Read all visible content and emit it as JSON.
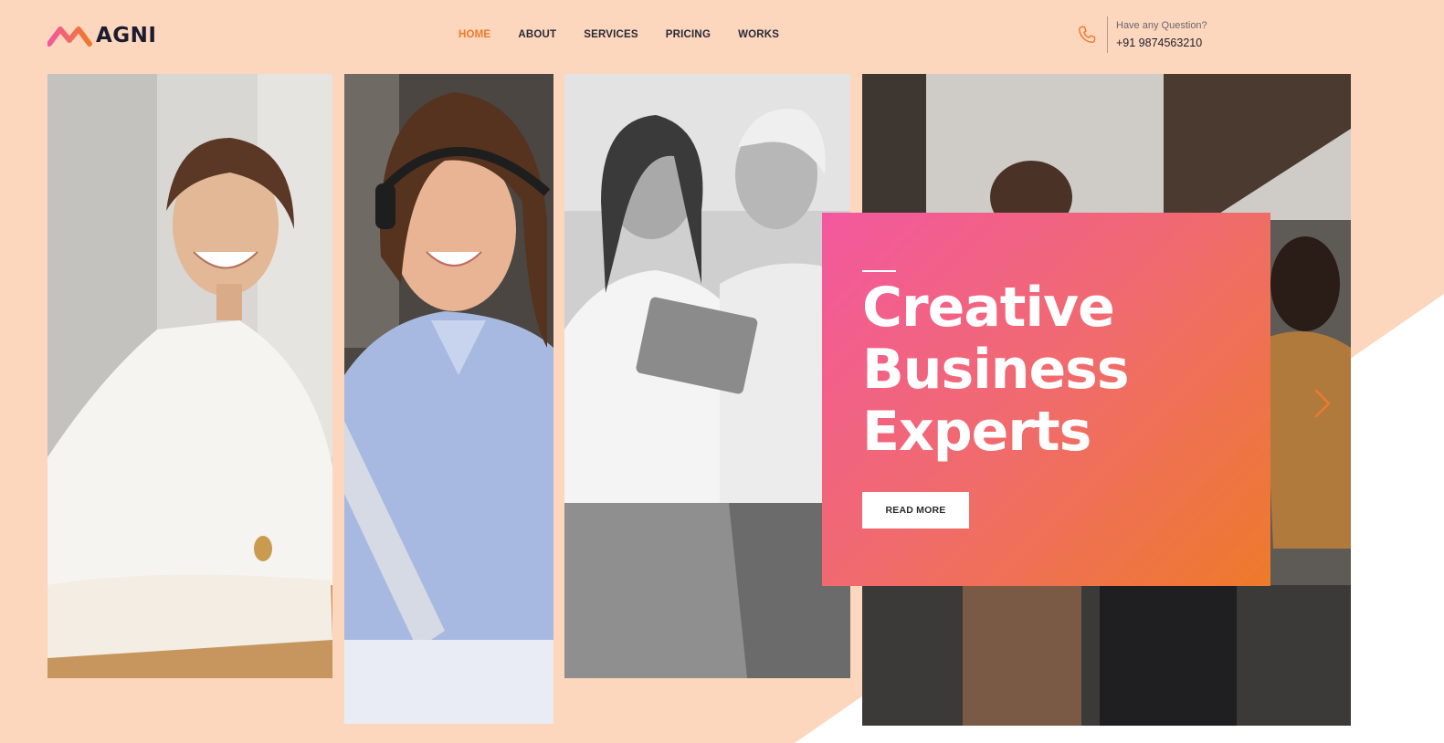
{
  "brand": {
    "name": "AGNI",
    "accent": "#ec7b2e",
    "gradient": [
      "#f3589f",
      "#ee7a2a"
    ],
    "background": "#fcd6bd"
  },
  "nav": {
    "items": [
      {
        "label": "HOME",
        "active": true
      },
      {
        "label": "ABOUT",
        "active": false
      },
      {
        "label": "SERVICES",
        "active": false
      },
      {
        "label": "PRICING",
        "active": false
      },
      {
        "label": "WORKS",
        "active": false
      }
    ]
  },
  "contact": {
    "icon": "phone-icon",
    "question": "Have any Question?",
    "phone": "+91 9874563210"
  },
  "hero": {
    "title_line1": "Creative",
    "title_line2": "Business",
    "title_line3": "Experts",
    "button_label": "READ MORE"
  },
  "slider": {
    "next_icon": "chevron-right-icon"
  },
  "photos": [
    {
      "name": "smiling-woman-photo"
    },
    {
      "name": "call-center-woman-photo"
    },
    {
      "name": "two-women-tablet-photo"
    },
    {
      "name": "team-meeting-photo"
    }
  ]
}
